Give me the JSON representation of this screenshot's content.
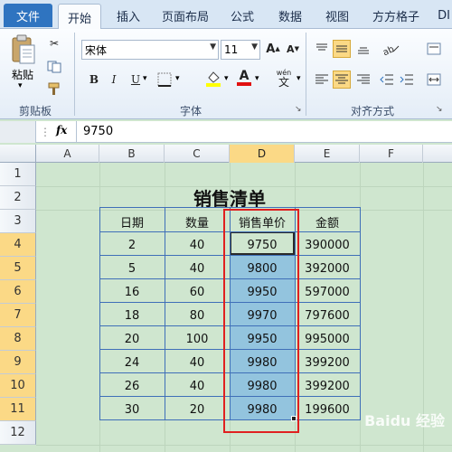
{
  "tabs": {
    "file": "文件",
    "home": "开始",
    "insert": "插入",
    "page_layout": "页面布局",
    "formulas": "公式",
    "data": "数据",
    "view": "视图",
    "fangfang": "方方格子",
    "more": "DI"
  },
  "ribbon": {
    "clipboard": {
      "paste": "粘贴",
      "label": "剪贴板"
    },
    "font": {
      "name": "宋体",
      "size": "11",
      "label": "字体",
      "bold": "B",
      "italic": "I",
      "underline": "U",
      "font_color": "A",
      "phonetic": "wén"
    },
    "alignment": {
      "label": "对齐方式"
    }
  },
  "formula_bar": {
    "fx": "fx",
    "value": "9750"
  },
  "columns": [
    "A",
    "B",
    "C",
    "D",
    "E",
    "F"
  ],
  "selected_column": "D",
  "rows": [
    "1",
    "2",
    "3",
    "4",
    "5",
    "6",
    "7",
    "8",
    "9",
    "10",
    "11",
    "12"
  ],
  "sheet": {
    "title": "销售清单",
    "headers": [
      "日期",
      "数量",
      "销售单价",
      "金额"
    ],
    "rows": [
      [
        "2",
        "40",
        "9750",
        "390000"
      ],
      [
        "5",
        "40",
        "9800",
        "392000"
      ],
      [
        "16",
        "60",
        "9950",
        "597000"
      ],
      [
        "18",
        "80",
        "9970",
        "797600"
      ],
      [
        "20",
        "100",
        "9950",
        "995000"
      ],
      [
        "24",
        "40",
        "9980",
        "399200"
      ],
      [
        "26",
        "40",
        "9980",
        "399200"
      ],
      [
        "30",
        "20",
        "9980",
        "199600"
      ]
    ]
  },
  "watermark": "Baidu 经验",
  "colors": {
    "selection": "#93c4de",
    "highlight_box": "#e02020",
    "sheet_bg": "#cfe6cf",
    "table_border": "#3f6fb8"
  }
}
